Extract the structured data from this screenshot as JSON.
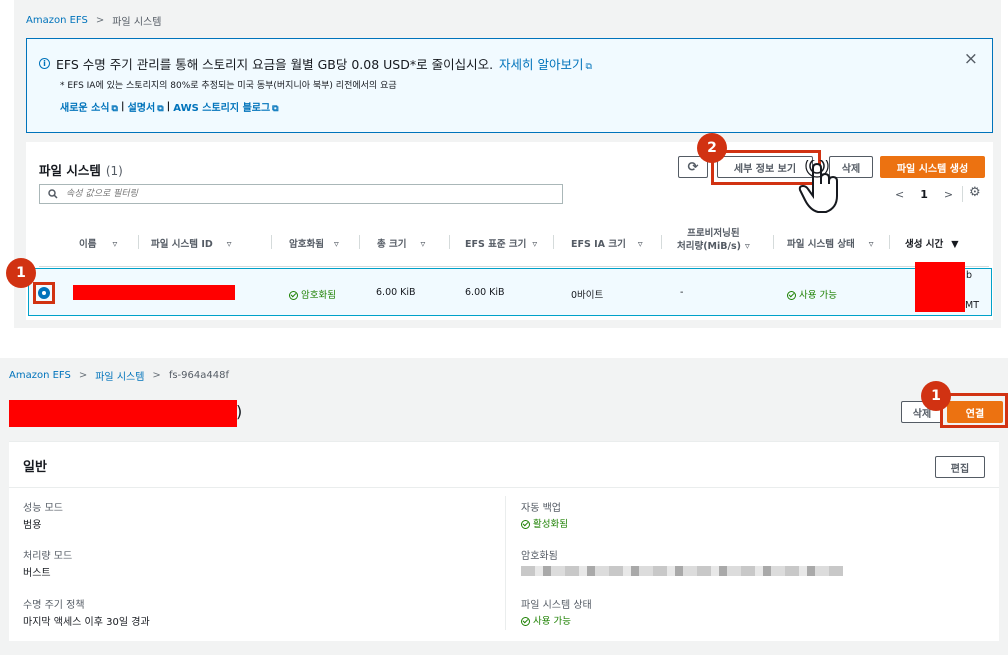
{
  "top": {
    "breadcrumb": {
      "root": "Amazon EFS",
      "sep": ">",
      "current": "파일 시스템"
    },
    "banner": {
      "title_prefix": "EFS 수명 주기 관리를 통해 스토리지 요금을 월별 GB당 0.08 USD*로 줄이십시오.",
      "learn_more": "자세히 알아보기",
      "footnote": "* EFS IA에 있는 스토리지의 80%로 추정되는 미국 동부(버지니아 북부) 리전에서의 요금",
      "links": [
        "새로운 소식",
        "설명서",
        "AWS 스토리지 블로그"
      ],
      "link_sep": "|",
      "close": "×"
    },
    "fs_panel": {
      "title": "파일 시스템",
      "count": "(1)",
      "buttons": {
        "refresh": "⟳",
        "details": "세부 정보 보기",
        "delete": "삭제",
        "create": "파일 시스템 생성"
      },
      "search_placeholder": "속성 값으로 필터링",
      "pagination": {
        "prev": "<",
        "page": "1",
        "next": ">"
      },
      "columns": [
        "이름",
        "파일 시스템 ID",
        "암호화됨",
        "총 크기",
        "EFS 표준 크기",
        "EFS IA 크기",
        "프로비저닝된",
        "처리량(MiB/s)",
        "파일 시스템 상태",
        "생성 시간"
      ],
      "row": {
        "encrypted": "암호화됨",
        "total_size": "6.00 KiB",
        "standard_size": "6.00 KiB",
        "ia_size": "0바이트",
        "throughput": "-",
        "state": "사용 가능",
        "created_frag1": "b",
        "created_frag2": "MT"
      },
      "badges": {
        "one": "1",
        "two": "2"
      }
    }
  },
  "bottom": {
    "breadcrumb": {
      "root": "Amazon EFS",
      "sep": ">",
      "mid": "파일 시스템",
      "current": "fs-964a448f"
    },
    "title_suffix": ")",
    "buttons": {
      "delete": "삭제",
      "connect": "연결",
      "edit": "편집"
    },
    "badge": "1",
    "general": {
      "heading": "일반",
      "left": [
        {
          "label": "성능 모드",
          "value": "범용"
        },
        {
          "label": "처리량 모드",
          "value": "버스트"
        },
        {
          "label": "수명 주기 정책",
          "value": "마지막 액세스 이후 30일 경과"
        }
      ],
      "right": {
        "backup_label": "자동 백업",
        "backup_value": "활성화됨",
        "encryption_label": "암호화됨",
        "state_label": "파일 시스템 상태",
        "state_value": "사용 가능"
      }
    }
  },
  "colors": {
    "accent": "#0073bb",
    "primary": "#ec7211",
    "highlight": "#d13212",
    "success": "#1d8102"
  }
}
